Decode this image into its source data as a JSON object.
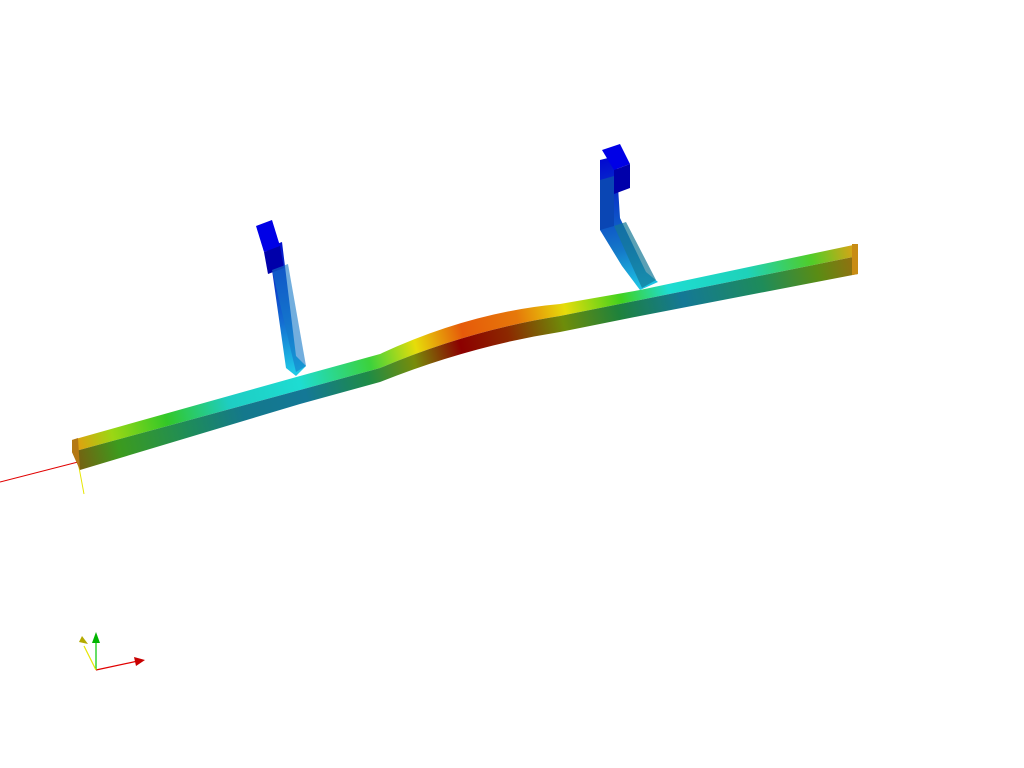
{
  "viewer": {
    "background": "#ffffff",
    "colormap": [
      "#0000c8",
      "#0a64d2",
      "#1ec8e6",
      "#14c896",
      "#32c81e",
      "#96dc14",
      "#f0dc00",
      "#f08c00",
      "#dc3c00",
      "#8c0000"
    ]
  },
  "model": {
    "name": "deformed-beam-with-two-supports",
    "colors": {
      "end_cap": "#e6a014",
      "support_top": "#0000d2",
      "peak": "#8c0000"
    }
  },
  "axes": {
    "x_color": "#e10000",
    "y_color": "#00c800",
    "z_color": "#e6e600",
    "x_icon": "arrow-x-icon",
    "y_icon": "arrow-y-icon",
    "z_icon": "arrow-z-icon"
  }
}
